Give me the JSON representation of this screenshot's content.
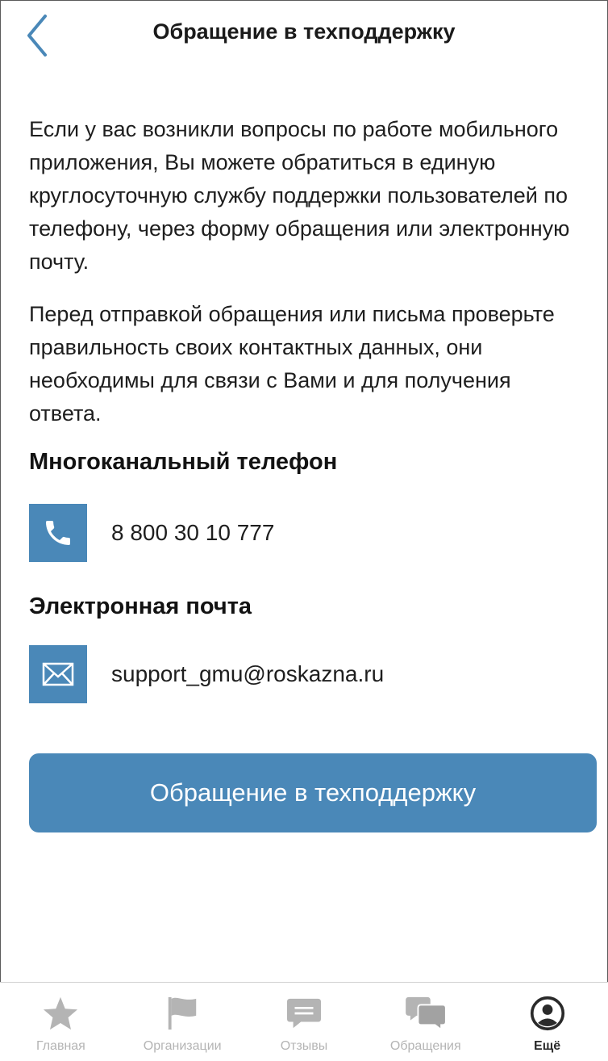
{
  "header": {
    "title": "Обращение в техподдержку"
  },
  "intro": {
    "paragraph1": "Если у вас возникли вопросы по работе мобильного приложения, Вы можете обратиться в единую круглосуточную службу поддержки пользователей по телефону, через форму обращения или электронную почту.",
    "paragraph2": "Перед отправкой обращения или письма проверьте правильность своих контактных данных, они необходимы для связи с Вами и для получения ответа."
  },
  "phone": {
    "heading": "Многоканальный телефон",
    "value": "8 800 30 10 777",
    "icon": "phone-icon"
  },
  "email": {
    "heading": "Электронная почта",
    "value": "support_gmu@roskazna.ru",
    "icon": "envelope-icon"
  },
  "cta": {
    "label": "Обращение в техподдержку"
  },
  "tabbar": {
    "items": [
      {
        "label": "Главная",
        "icon": "star-icon",
        "active": false
      },
      {
        "label": "Организации",
        "icon": "flag-icon",
        "active": false
      },
      {
        "label": "Отзывы",
        "icon": "comment-icon",
        "active": false
      },
      {
        "label": "Обращения",
        "icon": "chat-bubbles-icon",
        "active": false
      },
      {
        "label": "Ещё",
        "icon": "user-circle-icon",
        "active": true
      }
    ]
  },
  "colors": {
    "accent": "#4a88b8",
    "tab_inactive": "#b4b4b4",
    "tab_active": "#2a2a2a"
  }
}
